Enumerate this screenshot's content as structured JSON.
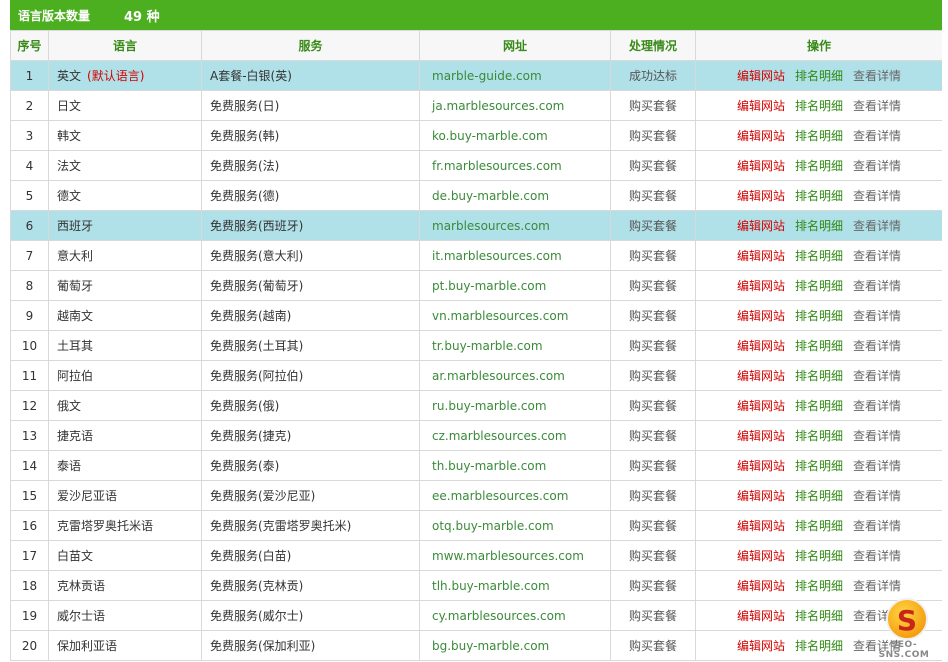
{
  "header": {
    "label": "语言版本数量",
    "count": "49 种"
  },
  "columns": {
    "index": "序号",
    "language": "语言",
    "service": "服务",
    "url": "网址",
    "status": "处理情况",
    "actions": "操作"
  },
  "actions": {
    "edit": "编辑网站",
    "rank": "排名明细",
    "detail": "查看详情"
  },
  "rows": [
    {
      "index": "1",
      "language": "英文",
      "tag": "(默认语言)",
      "service": "A套餐-白银(英)",
      "url": "marble-guide.com",
      "status": "成功达标"
    },
    {
      "index": "2",
      "language": "日文",
      "tag": "",
      "service": "免费服务(日)",
      "url": "ja.marblesources.com",
      "status": "购买套餐"
    },
    {
      "index": "3",
      "language": "韩文",
      "tag": "",
      "service": "免费服务(韩)",
      "url": "ko.buy-marble.com",
      "status": "购买套餐"
    },
    {
      "index": "4",
      "language": "法文",
      "tag": "",
      "service": "免费服务(法)",
      "url": "fr.marblesources.com",
      "status": "购买套餐"
    },
    {
      "index": "5",
      "language": "德文",
      "tag": "",
      "service": "免费服务(德)",
      "url": "de.buy-marble.com",
      "status": "购买套餐"
    },
    {
      "index": "6",
      "language": "西班牙",
      "tag": "",
      "service": "免费服务(西班牙)",
      "url": "marblesources.com",
      "status": "购买套餐"
    },
    {
      "index": "7",
      "language": "意大利",
      "tag": "",
      "service": "免费服务(意大利)",
      "url": "it.marblesources.com",
      "status": "购买套餐"
    },
    {
      "index": "8",
      "language": "葡萄牙",
      "tag": "",
      "service": "免费服务(葡萄牙)",
      "url": "pt.buy-marble.com",
      "status": "购买套餐"
    },
    {
      "index": "9",
      "language": "越南文",
      "tag": "",
      "service": "免费服务(越南)",
      "url": "vn.marblesources.com",
      "status": "购买套餐"
    },
    {
      "index": "10",
      "language": "土耳其",
      "tag": "",
      "service": "免费服务(土耳其)",
      "url": "tr.buy-marble.com",
      "status": "购买套餐"
    },
    {
      "index": "11",
      "language": "阿拉伯",
      "tag": "",
      "service": "免费服务(阿拉伯)",
      "url": "ar.marblesources.com",
      "status": "购买套餐"
    },
    {
      "index": "12",
      "language": "俄文",
      "tag": "",
      "service": "免费服务(俄)",
      "url": "ru.buy-marble.com",
      "status": "购买套餐"
    },
    {
      "index": "13",
      "language": "捷克语",
      "tag": "",
      "service": "免费服务(捷克)",
      "url": "cz.marblesources.com",
      "status": "购买套餐"
    },
    {
      "index": "14",
      "language": "泰语",
      "tag": "",
      "service": "免费服务(泰)",
      "url": "th.buy-marble.com",
      "status": "购买套餐"
    },
    {
      "index": "15",
      "language": "爱沙尼亚语",
      "tag": "",
      "service": "免费服务(爱沙尼亚)",
      "url": "ee.marblesources.com",
      "status": "购买套餐"
    },
    {
      "index": "16",
      "language": "克雷塔罗奥托米语",
      "tag": "",
      "service": "免费服务(克雷塔罗奥托米)",
      "url": "otq.buy-marble.com",
      "status": "购买套餐"
    },
    {
      "index": "17",
      "language": "白苗文",
      "tag": "",
      "service": "免费服务(白苗)",
      "url": "mww.marblesources.com",
      "status": "购买套餐"
    },
    {
      "index": "18",
      "language": "克林贡语",
      "tag": "",
      "service": "免费服务(克林贡)",
      "url": "tlh.buy-marble.com",
      "status": "购买套餐"
    },
    {
      "index": "19",
      "language": "威尔士语",
      "tag": "",
      "service": "免费服务(威尔士)",
      "url": "cy.marblesources.com",
      "status": "购买套餐"
    },
    {
      "index": "20",
      "language": "保加利亚语",
      "tag": "",
      "service": "免费服务(保加利亚)",
      "url": "bg.buy-marble.com",
      "status": "购买套餐"
    }
  ],
  "highlighted_rows": [
    "1",
    "6"
  ],
  "watermark": {
    "glyph": "S",
    "text": "SEO-SNS.COM"
  },
  "colors": {
    "header_bar": "#4caf1f",
    "highlight_row": "#b0e0e8",
    "edit_link": "#d40000",
    "rank_link": "#2f8a12"
  }
}
